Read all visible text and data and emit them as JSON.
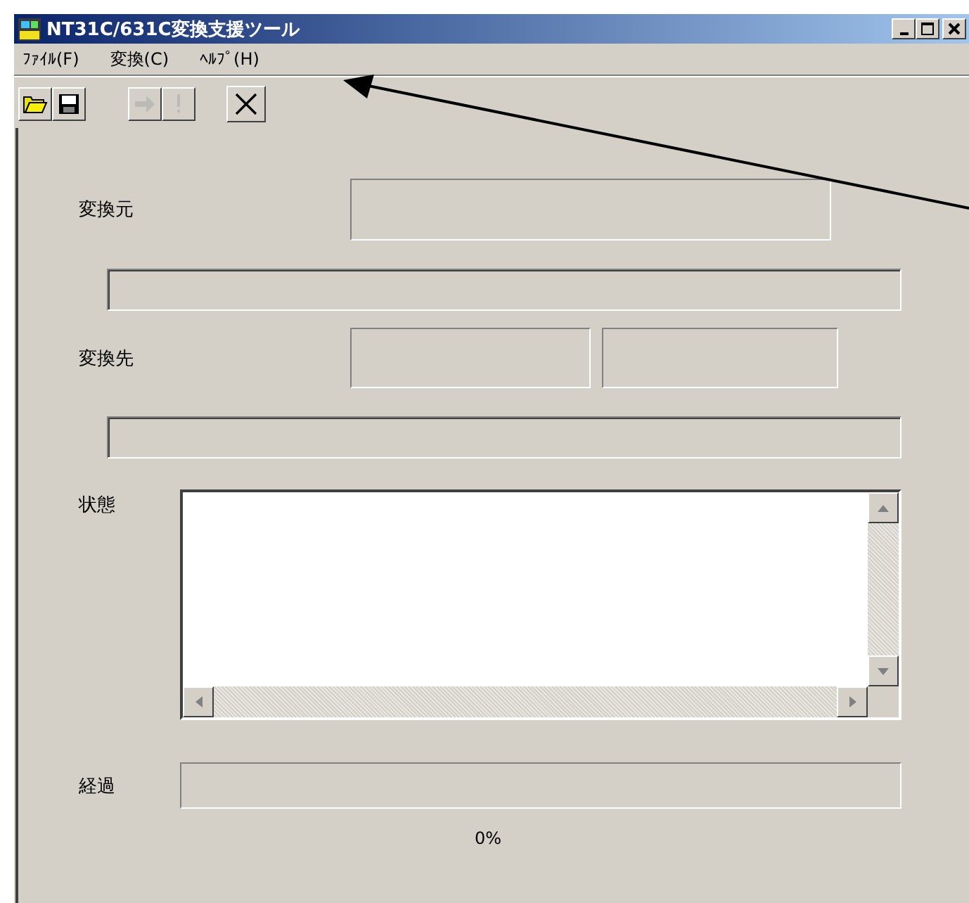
{
  "window": {
    "title": "NT31C/631C変換支援ツール"
  },
  "menu": [
    "ﾌｧｲﾙ(F)",
    "変換(C)",
    "ﾍﾙﾌﾟ(H)"
  ],
  "toolbar": [
    {
      "kind": "open",
      "disabled": false
    },
    {
      "kind": "save",
      "disabled": false
    },
    {
      "kind": "convert",
      "disabled": true
    },
    {
      "kind": "check",
      "disabled": true
    },
    {
      "kind": "exit",
      "disabled": false
    }
  ],
  "source": {
    "label": "変換元"
  },
  "target": {
    "label": "変換先"
  },
  "status": {
    "label": "状態"
  },
  "progress": {
    "label": "経過",
    "level": 0,
    "reading": "0%"
  }
}
